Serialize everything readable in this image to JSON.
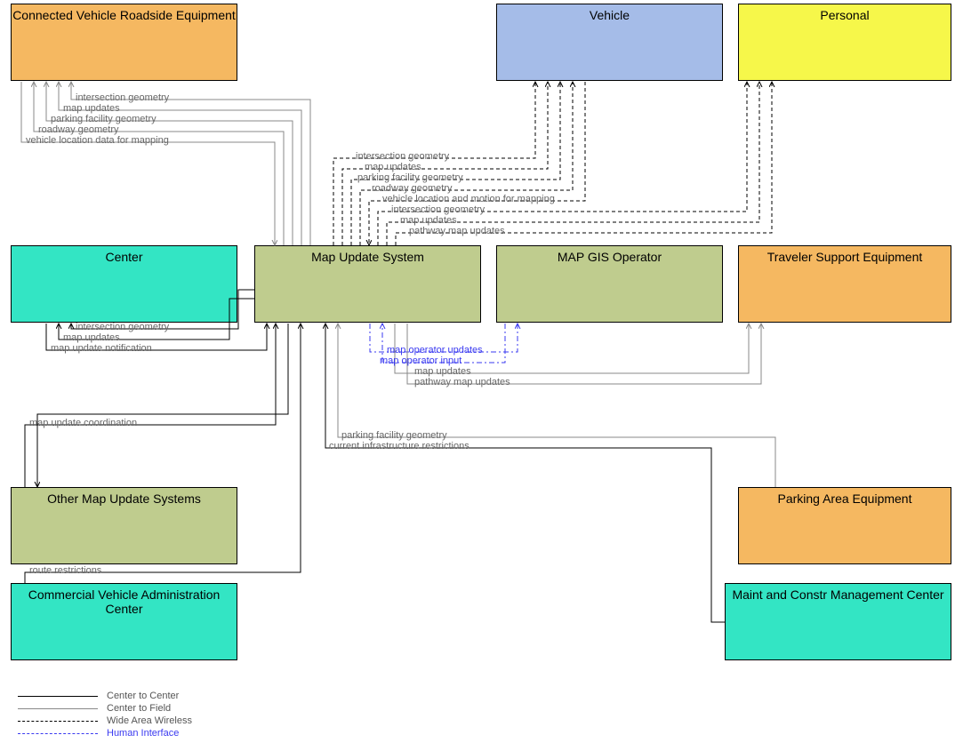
{
  "nodes": {
    "cvre": "Connected Vehicle Roadside Equipment",
    "vehicle": "Vehicle",
    "personal": "Personal",
    "center": "Center",
    "mus": "Map Update System",
    "gis": "MAP GIS Operator",
    "tse": "Traveler Support Equipment",
    "omus": "Other Map Update Systems",
    "cvac": "Commercial Vehicle Administration Center",
    "pae": "Parking Area Equipment",
    "mcmc": "Maint and Constr Management Center"
  },
  "flows": {
    "cvre1": "intersection geometry",
    "cvre2": "map updates",
    "cvre3": "parking facility geometry",
    "cvre4": "roadway geometry",
    "cvre5": "vehicle location data for mapping",
    "veh1": "intersection geometry",
    "veh2": "map updates",
    "veh3": "parking facility geometry",
    "veh4": "roadway geometry",
    "veh5": "vehicle location and motion for mapping",
    "pers1": "intersection geometry",
    "pers2": "map updates",
    "pers3": "pathway map updates",
    "ctr1": "intersection geometry",
    "ctr2": "map updates",
    "ctr3": "map update notification",
    "gis1": "map operator updates",
    "gis2": "map operator input",
    "tse1": "map updates",
    "tse2": "pathway map updates",
    "pae1": "parking facility geometry",
    "mcmc1": "current infrastructure restrictions",
    "omus1": "map update coordination",
    "cvac1": "route restrictions"
  },
  "legend": {
    "c2c": "Center to Center",
    "c2f": "Center to Field",
    "waw": "Wide Area Wireless",
    "hi": "Human Interface"
  }
}
